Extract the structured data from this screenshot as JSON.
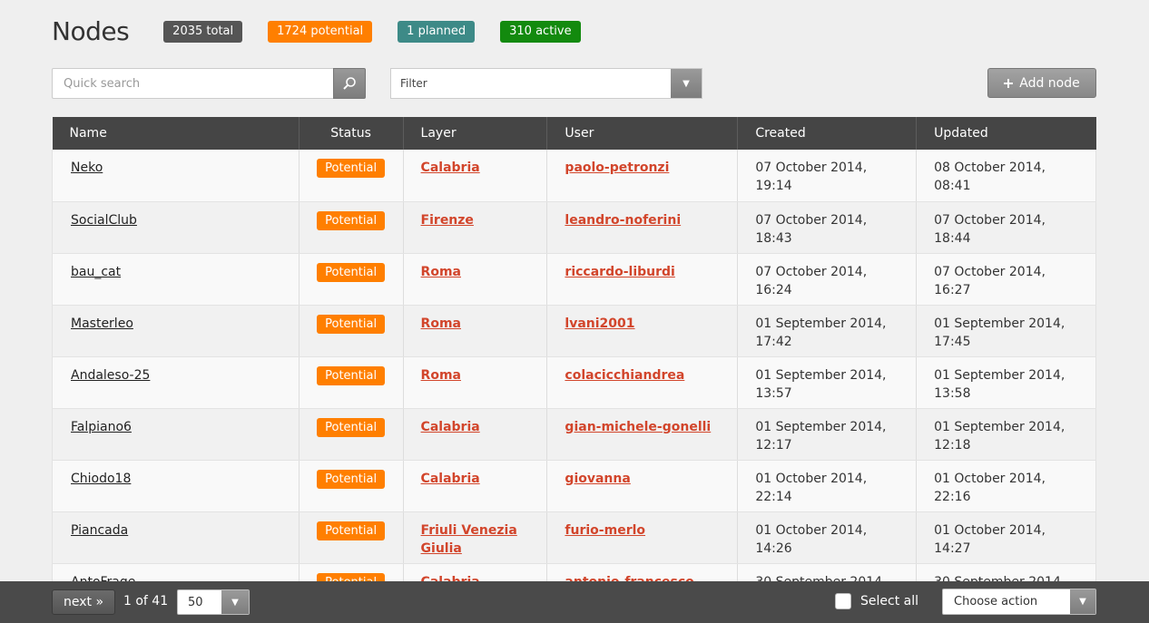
{
  "page_title": "Nodes",
  "badges": [
    {
      "label": "2035 total",
      "color": "#555555"
    },
    {
      "label": "1724 potential",
      "color": "#ff7f00"
    },
    {
      "label": "1 planned",
      "color": "#3d8a87"
    },
    {
      "label": "310 active",
      "color": "#138a0e"
    }
  ],
  "search": {
    "placeholder": "Quick search"
  },
  "filter": {
    "label": "Filter"
  },
  "add_node_label": "Add node",
  "table": {
    "headers": [
      "Name",
      "Status",
      "Layer",
      "User",
      "Created",
      "Updated"
    ],
    "rows": [
      {
        "name": "Neko",
        "status": "Potential",
        "layer": "Calabria",
        "user": "paolo-petronzi",
        "created": "07 October 2014, 19:14",
        "updated": "08 October 2014, 08:41"
      },
      {
        "name": "SocialClub",
        "status": "Potential",
        "layer": "Firenze",
        "user": "leandro-noferini",
        "created": "07 October 2014, 18:43",
        "updated": "07 October 2014, 18:44"
      },
      {
        "name": "bau_cat",
        "status": "Potential",
        "layer": "Roma",
        "user": "riccardo-liburdi",
        "created": "07 October 2014, 16:24",
        "updated": "07 October 2014, 16:27"
      },
      {
        "name": "Masterleo",
        "status": "Potential",
        "layer": "Roma",
        "user": "lvani2001",
        "created": "01 September 2014, 17:42",
        "updated": "01 September 2014, 17:45"
      },
      {
        "name": "Andaleso-25",
        "status": "Potential",
        "layer": "Roma",
        "user": "colacicchiandrea",
        "created": "01 September 2014, 13:57",
        "updated": "01 September 2014, 13:58"
      },
      {
        "name": "Falpiano6",
        "status": "Potential",
        "layer": "Calabria",
        "user": "gian-michele-gonelli",
        "created": "01 September 2014, 12:17",
        "updated": "01 September 2014, 12:18"
      },
      {
        "name": "Chiodo18",
        "status": "Potential",
        "layer": "Calabria",
        "user": "giovanna",
        "created": "01 October 2014, 22:14",
        "updated": "01 October 2014, 22:16"
      },
      {
        "name": "Piancada",
        "status": "Potential",
        "layer": "Friuli Venezia Giulia",
        "user": "furio-merlo",
        "created": "01 October 2014, 14:26",
        "updated": "01 October 2014, 14:27"
      },
      {
        "name": "AntoFrage",
        "status": "Potential",
        "layer": "Calabria",
        "user": "antonio-francesco-",
        "created": "30 September 2014,",
        "updated": "30 September 2014,"
      }
    ]
  },
  "footer": {
    "next_label": "next »",
    "page_info": "1 of 41",
    "page_size": "50",
    "select_all_label": "Select all",
    "choose_action_label": "Choose action"
  }
}
